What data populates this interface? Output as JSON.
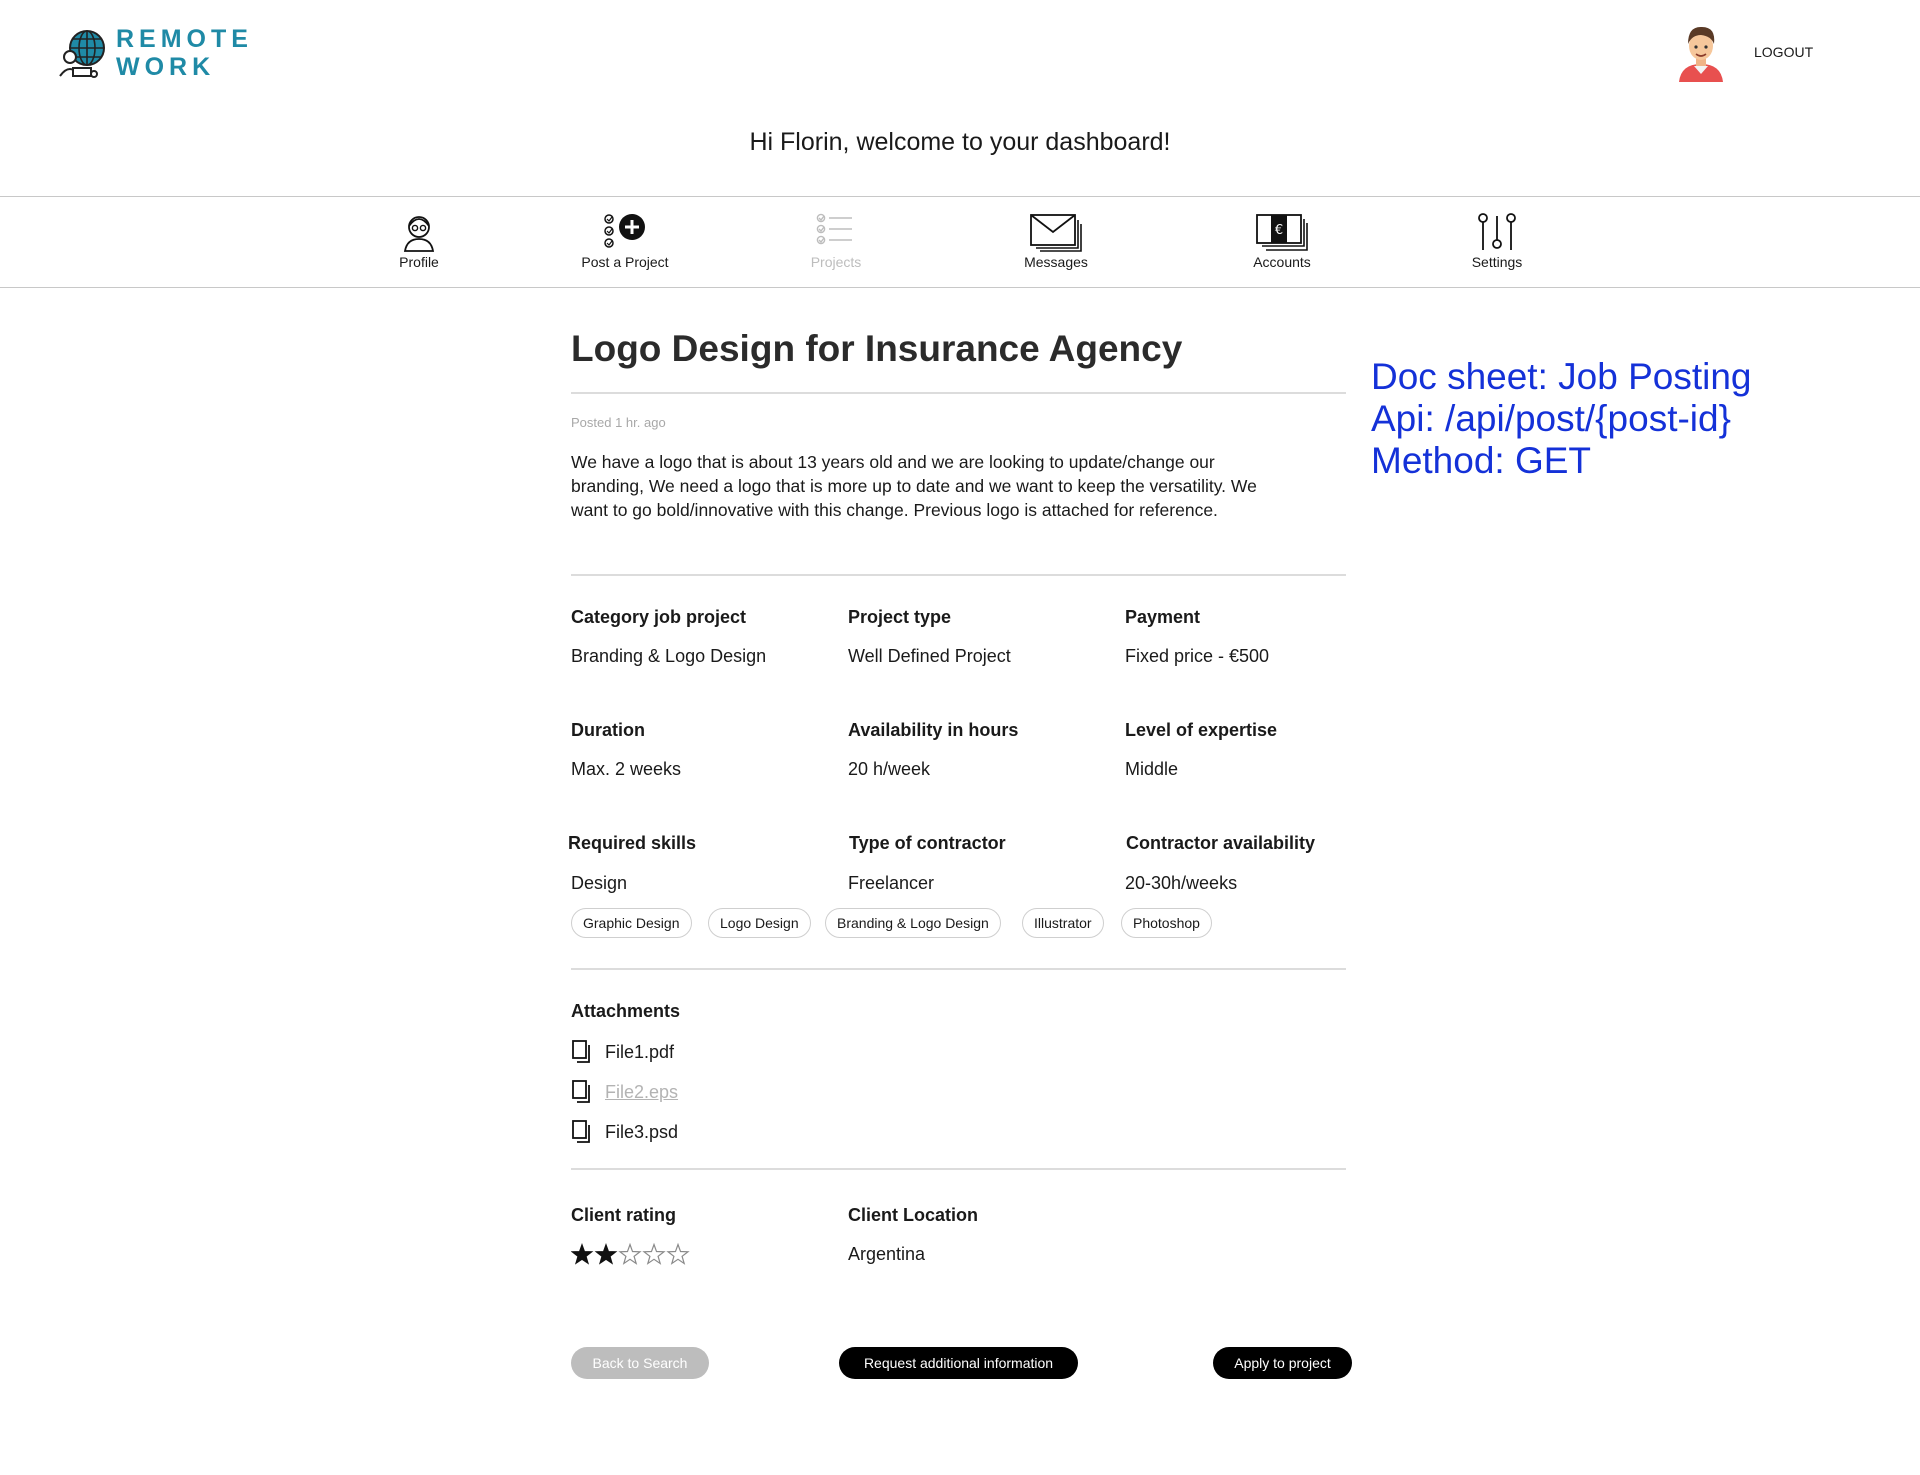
{
  "header": {
    "logo_line1": "REMOTE",
    "logo_line2": "WORK",
    "logout_label": "LOGOUT",
    "welcome": "Hi Florin, welcome to your dashboard!"
  },
  "nav": {
    "profile": "Profile",
    "post_project": "Post a Project",
    "projects": "Projects",
    "messages": "Messages",
    "accounts": "Accounts",
    "settings": "Settings"
  },
  "job": {
    "title": "Logo Design for Insurance Agency",
    "posted": "Posted 1 hr. ago",
    "description": "We have a logo that is about 13 years old and we are looking to update/change our branding,  We need a logo that is more up to date and we want to keep the versatility.  We want to go bold/innovative with this change. Previous logo is attached for reference."
  },
  "details": {
    "category": {
      "label": "Category job project",
      "value": "Branding & Logo Design"
    },
    "project_type": {
      "label": "Project type",
      "value": "Well Defined Project"
    },
    "payment": {
      "label": "Payment",
      "value": "Fixed price - €500"
    },
    "duration": {
      "label": "Duration",
      "value": "Max. 2 weeks"
    },
    "availability": {
      "label": "Availability in hours",
      "value": "20 h/week"
    },
    "expertise": {
      "label": "Level of expertise",
      "value": "Middle"
    },
    "skills": {
      "label": "Required skills",
      "value": "Design"
    },
    "contractor_type": {
      "label": "Type of contractor",
      "value": "Freelancer"
    },
    "contractor_availability": {
      "label": "Contractor availability",
      "value": "20-30h/weeks"
    }
  },
  "skill_tags": [
    "Graphic Design",
    "Logo Design",
    "Branding & Logo Design",
    "Illustrator",
    "Photoshop"
  ],
  "attachments": {
    "label": "Attachments",
    "files": [
      "File1.pdf",
      "File2.eps",
      "File3.psd"
    ]
  },
  "client": {
    "rating_label": "Client rating",
    "rating": 2,
    "rating_max": 5,
    "location_label": "Client Location",
    "location": "Argentina"
  },
  "actions": {
    "back": "Back to Search",
    "request": "Request additional information",
    "apply": "Apply to project"
  },
  "doc_note": {
    "line1": "Doc sheet: Job Posting",
    "line2": "Api: /api/post/{post-id}",
    "line3": "Method: GET"
  },
  "colors": {
    "brand": "#1f8aa6",
    "note": "#1431d8",
    "disabled": "#bdbdbd"
  },
  "icons": [
    "globe-person-icon",
    "avatar",
    "profile-icon",
    "post-project-icon",
    "projects-icon",
    "messages-icon",
    "accounts-icon",
    "settings-icon",
    "file-icon",
    "star-icon"
  ]
}
